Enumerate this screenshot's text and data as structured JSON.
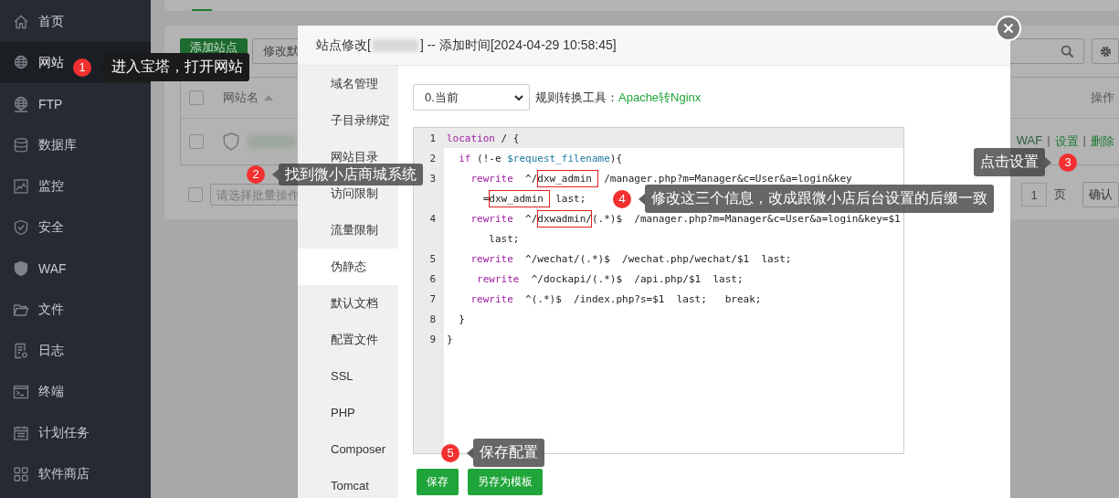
{
  "sidebar": {
    "items": [
      {
        "label": "首页",
        "selected": false
      },
      {
        "label": "网站",
        "selected": true
      },
      {
        "label": "FTP",
        "selected": false
      },
      {
        "label": "数据库",
        "selected": false
      },
      {
        "label": "监控",
        "selected": false
      },
      {
        "label": "安全",
        "selected": false
      },
      {
        "label": "WAF",
        "selected": false
      },
      {
        "label": "文件",
        "selected": false
      },
      {
        "label": "日志",
        "selected": false
      },
      {
        "label": "终端",
        "selected": false
      },
      {
        "label": "计划任务",
        "selected": false
      },
      {
        "label": "软件商店",
        "selected": false
      }
    ]
  },
  "site_list": {
    "add_button": "添加站点",
    "modify_button": "修改默",
    "name_column": "网站名",
    "action_column": "操作",
    "header_checked": false,
    "row_checked": false,
    "footer_checked": false,
    "row_links": [
      {
        "text": "WAF"
      },
      {
        "text": "设置",
        "separator": "|"
      },
      {
        "text": "删除",
        "separator": "|"
      }
    ],
    "batch_placeholder": "请选择批量操作",
    "page_number": "1",
    "page_suffix": "页",
    "confirm_button": "确认"
  },
  "dialog": {
    "title_prefix": "站点修改[",
    "title_suffix": "] -- 添加时间[2024-04-29 10:58:45]",
    "menu": [
      {
        "label": "域名管理",
        "selected": false
      },
      {
        "label": "子目录绑定",
        "selected": false
      },
      {
        "label": "网站目录",
        "selected": false
      },
      {
        "label": "访问限制",
        "selected": false
      },
      {
        "label": "流量限制",
        "selected": false
      },
      {
        "label": "伪静态",
        "selected": true
      },
      {
        "label": "默认文档",
        "selected": false
      },
      {
        "label": "配置文件",
        "selected": false
      },
      {
        "label": "SSL",
        "selected": false
      },
      {
        "label": "PHP",
        "selected": false
      },
      {
        "label": "Composer",
        "selected": false
      },
      {
        "label": "Tomcat",
        "selected": false
      }
    ],
    "version_select": "0.当前",
    "tool_label": "规则转换工具：",
    "tool_link": "Apache转Nginx",
    "code_lines": [
      {
        "number": "1",
        "active": true,
        "rows": [
          {
            "parts": [
              {
                "text": "location",
                "kind": "keyword"
              },
              {
                "text": " / {",
                "kind": "plain"
              }
            ]
          }
        ]
      },
      {
        "number": "2",
        "active": false,
        "rows": [
          {
            "parts": [
              {
                "text": "  if",
                "kind": "keyword"
              },
              {
                "text": " (!-e ",
                "kind": "plain"
              },
              {
                "text": "$request_filename",
                "kind": "variable"
              },
              {
                "text": "){",
                "kind": "plain"
              }
            ]
          }
        ]
      },
      {
        "number": "3",
        "active": false,
        "rows": [
          {
            "parts": [
              {
                "text": "    rewrite",
                "kind": "keyword"
              },
              {
                "text": "  ^/",
                "kind": "plain"
              },
              {
                "text": "dxw_admin ",
                "kind": "marked"
              },
              {
                "text": " /manager.php?m=Manager&c=User&a=login&key",
                "kind": "plain"
              }
            ]
          },
          {
            "parts": [
              {
                "text": "      =",
                "kind": "plain"
              },
              {
                "text": "dxw_admin ",
                "kind": "marked"
              },
              {
                "text": " last;",
                "kind": "plain"
              }
            ]
          }
        ]
      },
      {
        "number": "4",
        "active": false,
        "rows": [
          {
            "parts": [
              {
                "text": "    rewrite",
                "kind": "keyword"
              },
              {
                "text": "  ^/",
                "kind": "plain"
              },
              {
                "text": "dxwadmin/",
                "kind": "marked"
              },
              {
                "text": "(.*)$  /manager.php?m=Manager&c=User&a=login&key=$1",
                "kind": "plain"
              }
            ]
          },
          {
            "parts": [
              {
                "text": "       last;",
                "kind": "plain"
              }
            ]
          }
        ]
      },
      {
        "number": "5",
        "active": false,
        "rows": [
          {
            "parts": [
              {
                "text": "    rewrite",
                "kind": "keyword"
              },
              {
                "text": "  ^/wechat/(.*)$  /wechat.php/wechat/$1  last;",
                "kind": "plain"
              }
            ]
          }
        ]
      },
      {
        "number": "6",
        "active": false,
        "rows": [
          {
            "parts": [
              {
                "text": "     rewrite",
                "kind": "keyword"
              },
              {
                "text": "  ^/dockapi/(.*)$  /api.php/$1  last;",
                "kind": "plain"
              }
            ]
          }
        ]
      },
      {
        "number": "7",
        "active": false,
        "rows": [
          {
            "parts": [
              {
                "text": "    rewrite",
                "kind": "keyword"
              },
              {
                "text": "  ^(.*)$  /index.php?s=$1  last;   break;",
                "kind": "plain"
              }
            ]
          }
        ]
      },
      {
        "number": "8",
        "active": false,
        "rows": [
          {
            "parts": [
              {
                "text": "  }",
                "kind": "plain"
              }
            ]
          }
        ]
      },
      {
        "number": "9",
        "active": false,
        "rows": [
          {
            "parts": [
              {
                "text": "}",
                "kind": "plain"
              }
            ]
          }
        ]
      }
    ],
    "buttons": [
      "保存",
      "另存为模板"
    ]
  },
  "annotations": [
    {
      "number": "1",
      "text": "进入宝塔，打开网站"
    },
    {
      "number": "2",
      "text": "找到微小店商城系统"
    },
    {
      "number": "3",
      "text": "点击设置"
    },
    {
      "number": "4",
      "text": "修改这三个信息，改成跟微小店后台设置的后缀一致"
    },
    {
      "number": "5",
      "text": "保存配置"
    }
  ]
}
